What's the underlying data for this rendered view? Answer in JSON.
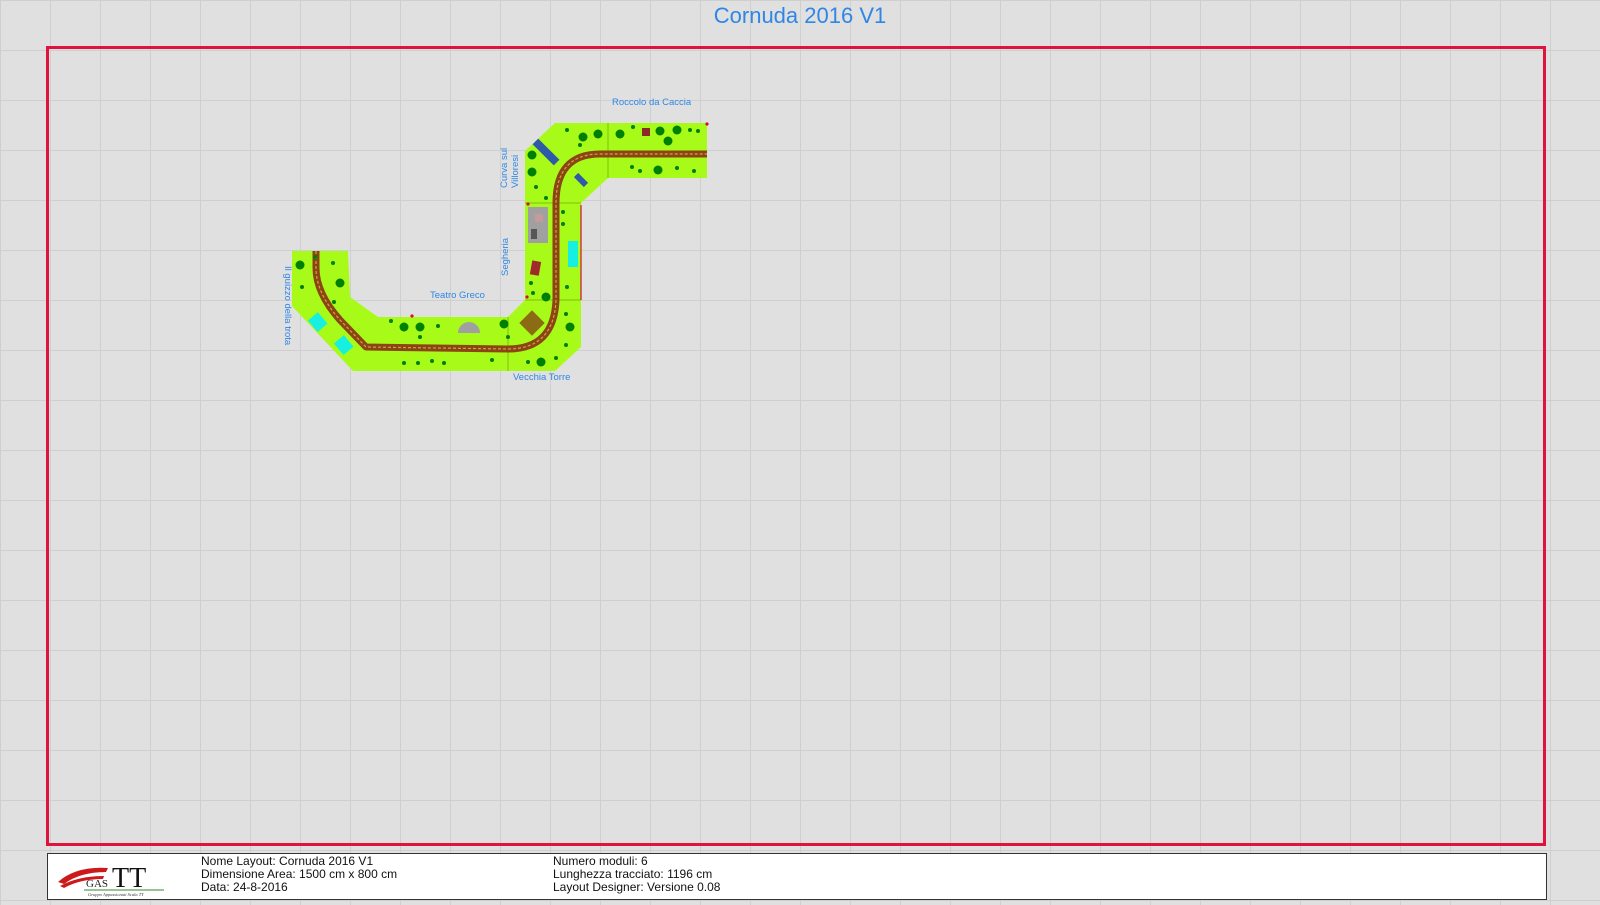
{
  "title": "Cornuda 2016 V1",
  "colors": {
    "grid": "#cfcfcf",
    "frame": "#e0123e",
    "title": "#2f86e6",
    "module_green": "#a8fb18",
    "track": "#8b4513",
    "tree": "#008000"
  },
  "module_labels": {
    "roccolo": "Roccolo da Caccia",
    "curva": "Curva sul Villoresi",
    "segheria": "Segheria",
    "teatro": "Teatro Greco",
    "guizzo": "Il guizzo della trota",
    "torre": "Vecchia Torre"
  },
  "info": {
    "nome_layout": "Nome Layout: Cornuda 2016 V1",
    "dimensione": "Dimensione Area: 1500 cm x 800 cm",
    "data": "Data: 24-8-2016",
    "numero_moduli": "Numero moduli: 6",
    "lunghezza": "Lunghezza tracciato: 1196 cm",
    "designer": "Layout Designer: Versione 0.08"
  },
  "logo": {
    "gas": "GAS",
    "tt": "TT",
    "subtitle": "Gruppo Appassionati Scala TT"
  }
}
